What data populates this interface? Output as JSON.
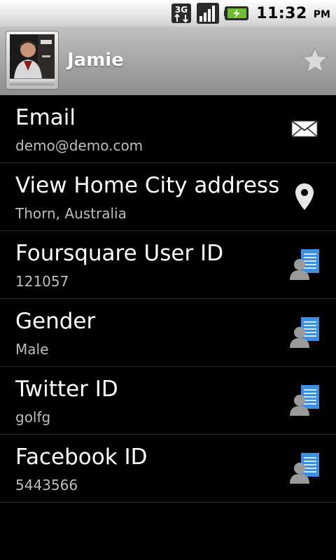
{
  "status_bar": {
    "network_badge": "3G",
    "time": "11:32",
    "ampm": "PM",
    "icons": [
      "3g-data-icon",
      "signal-strength-icon",
      "battery-charging-icon"
    ]
  },
  "header": {
    "contact_name": "Jamie",
    "photo_icon": "contact-photo",
    "favorite_icon": "star-icon"
  },
  "details": [
    {
      "label": "Email",
      "value": "demo@demo.com",
      "action_icon": "email-icon"
    },
    {
      "label": "View Home City address",
      "value": "Thorn, Australia",
      "action_icon": "map-pin-icon"
    },
    {
      "label": "Foursquare User ID",
      "value": "121057",
      "action_icon": "contact-card-icon"
    },
    {
      "label": "Gender",
      "value": "Male",
      "action_icon": "contact-card-icon"
    },
    {
      "label": "Twitter ID",
      "value": "golfg",
      "action_icon": "contact-card-icon"
    },
    {
      "label": "Facebook ID",
      "value": "5443566",
      "action_icon": "contact-card-icon"
    }
  ],
  "colors": {
    "background": "#000000",
    "header_gradient_top": "#c2c2c2",
    "header_gradient_bottom": "#8f8f8f",
    "secondary_text": "#bdbdbd",
    "card_icon_blue": "#3a8fe0"
  }
}
